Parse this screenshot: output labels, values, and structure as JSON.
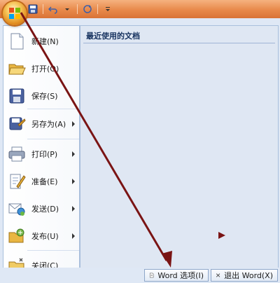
{
  "menu_items": [
    {
      "label": "新建(N)",
      "icon": "new-document-icon",
      "has_submenu": false
    },
    {
      "label": "打开(O)",
      "icon": "open-folder-icon",
      "has_submenu": false
    },
    {
      "label": "保存(S)",
      "icon": "save-disk-icon",
      "has_submenu": false
    },
    {
      "label": "另存为(A)",
      "icon": "save-as-icon",
      "has_submenu": true
    },
    {
      "label": "打印(P)",
      "icon": "printer-icon",
      "has_submenu": true
    },
    {
      "label": "准备(E)",
      "icon": "prepare-pencil-icon",
      "has_submenu": true
    },
    {
      "label": "发送(D)",
      "icon": "send-icon",
      "has_submenu": true
    },
    {
      "label": "发布(U)",
      "icon": "publish-folder-icon",
      "has_submenu": true
    },
    {
      "label": "关闭(C)",
      "icon": "close-folder-icon",
      "has_submenu": false
    }
  ],
  "recent": {
    "title": "最近使用的文档"
  },
  "footer": {
    "options_label": "Word 选项(I)",
    "exit_label": "退出 Word(X)"
  },
  "colors": {
    "title_bar": "#e8894a",
    "arrow": "#7a1414",
    "menu_bg": "#dfe8f5"
  }
}
